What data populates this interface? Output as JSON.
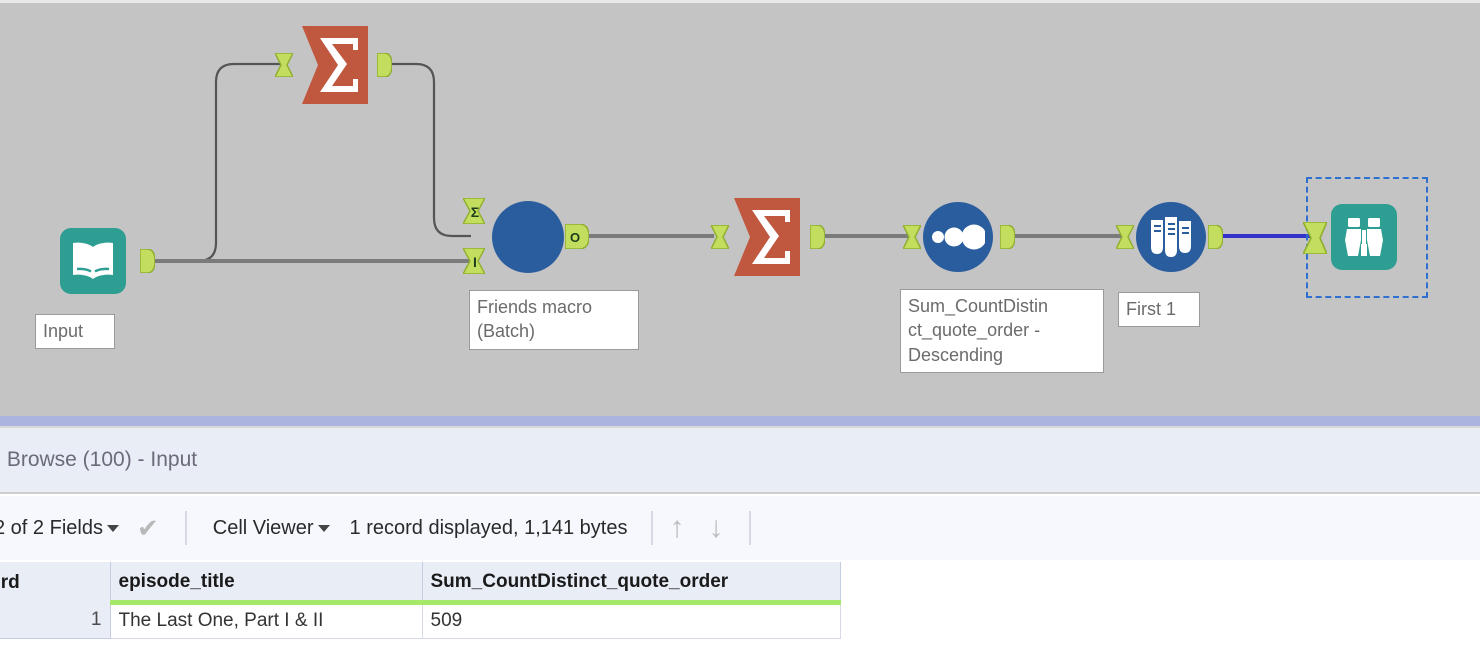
{
  "canvas": {
    "background_color": "#c4c4c4",
    "tools": [
      {
        "id": "input",
        "icon": "book-icon",
        "kind": "input-data-tool",
        "label": "Input",
        "color": "#2e9e92"
      },
      {
        "id": "summarize-top",
        "icon": "sigma-icon",
        "kind": "summarize-tool",
        "label": "",
        "color": "#c0573f"
      },
      {
        "id": "friends-macro",
        "icon": "batch-macro-icon",
        "kind": "batch-macro-tool",
        "label": "Friends macro\n(Batch)",
        "color": "#2a5d9e",
        "ports": {
          "in_top": "Σ",
          "in_bottom": "I",
          "out": "O"
        }
      },
      {
        "id": "summarize-main",
        "icon": "sigma-icon",
        "kind": "summarize-tool",
        "label": "",
        "color": "#c0573f"
      },
      {
        "id": "sort",
        "icon": "sort-dots-icon",
        "kind": "sort-tool",
        "label": "Sum_CountDistin\nct_quote_order -\nDescending",
        "color": "#2a5d9e"
      },
      {
        "id": "sample",
        "icon": "test-tubes-icon",
        "kind": "sample-tool",
        "label": "First 1",
        "color": "#2a5d9e"
      },
      {
        "id": "browse",
        "icon": "binoculars-icon",
        "kind": "browse-tool",
        "label": "",
        "color": "#2e9e92",
        "selected": true
      }
    ],
    "selected_connection_color": "#3333cc",
    "wire_color": "#6e6e6e",
    "port_color": "#c3de5e"
  },
  "results": {
    "accent_color": "#aab4de",
    "title": "- Browse (100) - Input",
    "toolbar": {
      "fields_label": "2 of 2 Fields",
      "check_icon": "✔",
      "view_mode": "Cell Viewer",
      "record_status": "1 record displayed, 1,141 bytes",
      "arrow_up": "↑",
      "arrow_down": "↓"
    },
    "table": {
      "columns": [
        "ecord",
        "episode_title",
        "Sum_CountDistinct_quote_order"
      ],
      "rows": [
        {
          "record": "1",
          "episode_title": "The Last One, Part I & II",
          "sum_countdistinct_quote_order": "509"
        }
      ],
      "header_underline_color": "#a6e86a"
    }
  }
}
